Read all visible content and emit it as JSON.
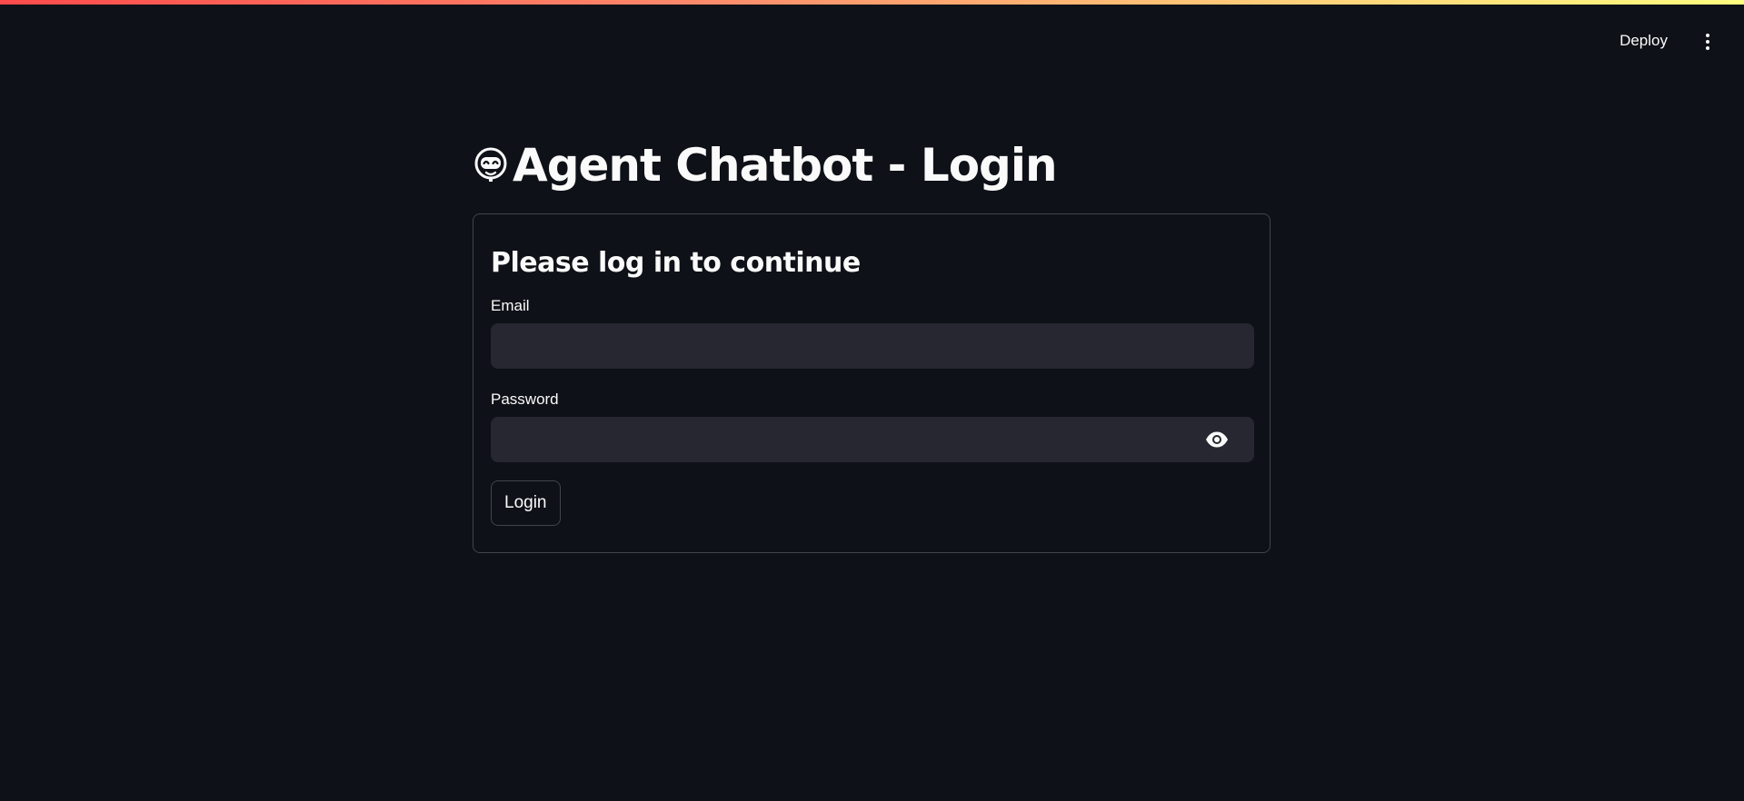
{
  "header": {
    "deploy_label": "Deploy",
    "menu_icon": "vertical-dots-icon"
  },
  "page": {
    "title_icon": "robot-face-icon",
    "title": "Agent Chatbot - Login"
  },
  "form": {
    "heading": "Please log in to continue",
    "email": {
      "label": "Email",
      "value": "",
      "placeholder": ""
    },
    "password": {
      "label": "Password",
      "value": "",
      "placeholder": "",
      "toggle_icon": "eye-icon"
    },
    "submit_label": "Login"
  },
  "colors": {
    "background": "#0e1117",
    "input_background": "#262730",
    "text": "#fafafa",
    "accent": "#ff4b4b"
  }
}
